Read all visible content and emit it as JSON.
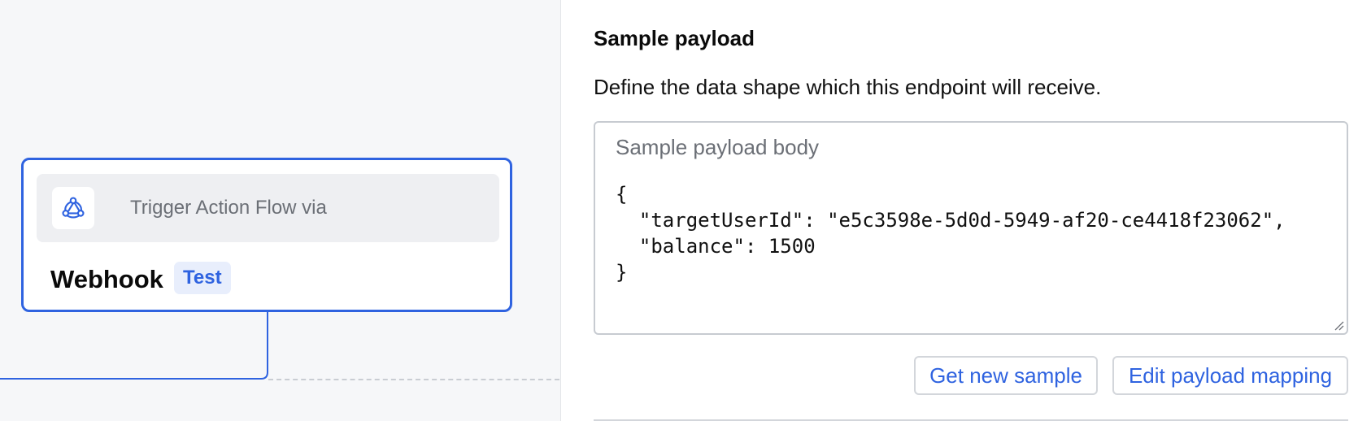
{
  "canvas": {
    "node": {
      "trigger_label": "Trigger Action Flow via",
      "title": "Webhook",
      "badge": "Test",
      "icon": "webhook-icon"
    }
  },
  "panel": {
    "title": "Sample payload",
    "description": "Define the data shape which this endpoint will receive.",
    "payload": {
      "label": "Sample payload body",
      "body": "{\n  \"targetUserId\": \"e5c3598e-5d0d-5949-af20-ce4418f23062\",\n  \"balance\": 1500\n}"
    },
    "buttons": {
      "get_sample": "Get new sample",
      "edit_mapping": "Edit payload mapping"
    }
  },
  "colors": {
    "accent": "#2f63e0",
    "canvas_background": "#f6f7f9",
    "badge_background": "#e8eefc"
  }
}
